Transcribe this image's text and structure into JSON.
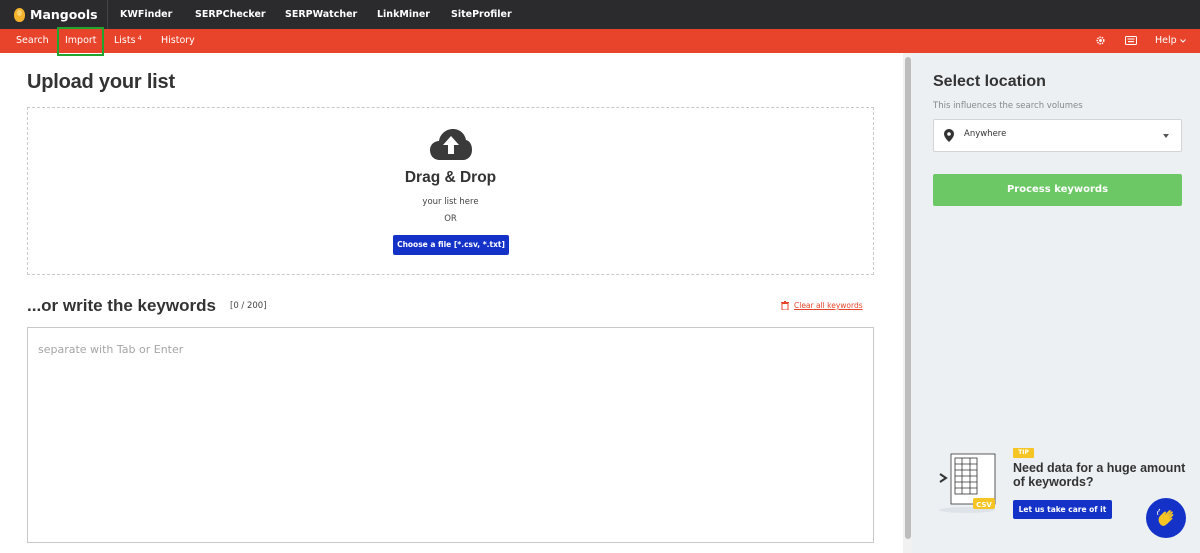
{
  "app": {
    "brand": "Mangools"
  },
  "topnav": [
    {
      "label": "KWFinder",
      "active": true
    },
    {
      "label": "SERPChecker"
    },
    {
      "label": "SERPWatcher"
    },
    {
      "label": "LinkMiner"
    },
    {
      "label": "SiteProfiler"
    }
  ],
  "subnav": {
    "search": "Search",
    "import": "Import",
    "lists": "Lists",
    "lists_count": "4",
    "history": "History",
    "help": "Help"
  },
  "upload": {
    "title": "Upload your list",
    "drag_title": "Drag & Drop",
    "drag_sub": "your list here",
    "or": "OR",
    "choose_button": "Choose a file [*.csv, *.txt]"
  },
  "keywords": {
    "title": "...or write the keywords",
    "counter": "[0 / 200]",
    "clear_link": "Clear all keywords",
    "placeholder": "separate with Tab or Enter"
  },
  "location": {
    "title": "Select location",
    "subtitle": "This influences the search volumes",
    "selected": "Anywhere",
    "process_button": "Process keywords"
  },
  "tip": {
    "badge": "TIP",
    "title": "Need data for a huge amount of keywords?",
    "button": "Let us take care of it",
    "file_label": "CSV"
  },
  "colors": {
    "topbar": "#2b2b2d",
    "accent_red": "#e8442b",
    "primary_blue": "#1432c8",
    "process_green": "#6cc865",
    "highlight_green": "#22a52f",
    "tip_yellow": "#f6c523"
  },
  "icons": [
    "mangools-logo-icon",
    "gear-icon",
    "keyboard-icon",
    "chevron-down-icon",
    "cloud-upload-icon",
    "trash-icon",
    "map-pin-icon",
    "caret-down-icon",
    "csv-file-icon",
    "wave-hand-icon"
  ]
}
